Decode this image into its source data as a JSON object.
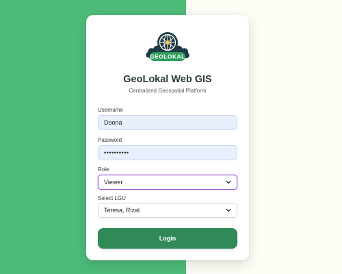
{
  "app": {
    "title": "GeoLokal Web GIS",
    "subtitle": "Centralized Geospatial Platform",
    "logo_text": "GEOLOKAL"
  },
  "form": {
    "username": {
      "label": "Username",
      "value": "Doona"
    },
    "password": {
      "label": "Password",
      "masked_value": "••••••••••"
    },
    "role": {
      "label": "Role",
      "selected": "Viewer"
    },
    "lgu": {
      "label": "Select LGU",
      "selected": "Teresa, Rizal"
    },
    "login_label": "Login"
  },
  "colors": {
    "background_left": "#4cbb78",
    "background_right": "#fdfcf5",
    "primary_button": "#2f8a58",
    "focus_ring": "#a25bd6",
    "logo_dark": "#1f3a44"
  },
  "icons": {
    "logo": "globe-logo-icon",
    "dropdown": "chevron-down-icon"
  }
}
